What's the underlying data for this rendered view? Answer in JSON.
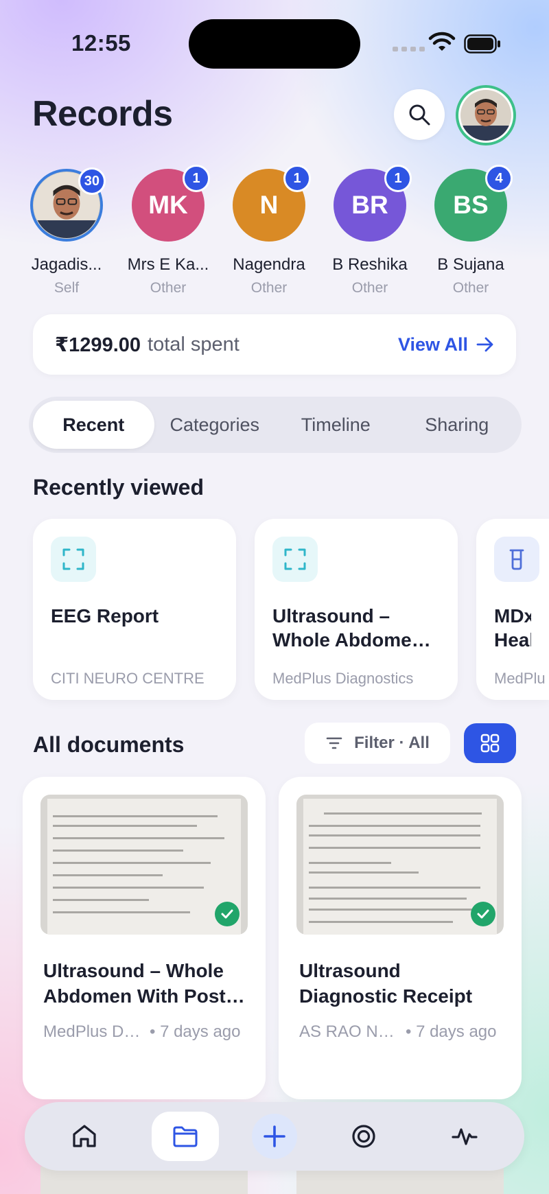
{
  "status_bar": {
    "time": "12:55"
  },
  "header": {
    "title": "Records"
  },
  "people": [
    {
      "name": "Jagadis...",
      "relation": "Self",
      "badge": "30",
      "initials": "",
      "color": "#3b7ddd"
    },
    {
      "name": "Mrs E Ka...",
      "relation": "Other",
      "badge": "1",
      "initials": "MK",
      "color": "#d24f7d"
    },
    {
      "name": "Nagendra",
      "relation": "Other",
      "badge": "1",
      "initials": "N",
      "color": "#d98a25"
    },
    {
      "name": "B Reshika",
      "relation": "Other",
      "badge": "1",
      "initials": "BR",
      "color": "#7657d8"
    },
    {
      "name": "B Sujana",
      "relation": "Other",
      "badge": "4",
      "initials": "BS",
      "color": "#3aa971"
    }
  ],
  "spend": {
    "amount": "₹1299.00",
    "label": "total spent",
    "view_all": "View All"
  },
  "tabs": [
    {
      "label": "Recent",
      "active": true
    },
    {
      "label": "Categories",
      "active": false
    },
    {
      "label": "Timeline",
      "active": false
    },
    {
      "label": "Sharing",
      "active": false
    }
  ],
  "recently_viewed": {
    "title": "Recently viewed",
    "items": [
      {
        "title": "EEG Report",
        "subtitle": "CITI NEURO CENTRE",
        "icon": "scan-icon"
      },
      {
        "title": "Ultrasound – Whole Abdome…",
        "subtitle": "MedPlus Diagnostics",
        "icon": "scan-icon"
      },
      {
        "title": "MDx Health",
        "subtitle": "MedPlu",
        "icon": "test-tube-icon"
      }
    ]
  },
  "all_documents": {
    "title": "All documents",
    "filter_label": "Filter · All",
    "items": [
      {
        "title": "Ultrasound – Whole Abdomen With Post…",
        "source": "MedPlus Di…",
        "time": "• 7 days ago",
        "verified": true
      },
      {
        "title": "Ultrasound Diagnostic Receipt",
        "source": "AS RAO NA…",
        "time": "• 7 days ago",
        "verified": true
      }
    ]
  },
  "bottom_nav": [
    "home-icon",
    "folder-icon",
    "plus-icon",
    "target-icon",
    "pulse-icon"
  ],
  "colors": {
    "accent": "#2e55e4",
    "success": "#21a56a"
  }
}
